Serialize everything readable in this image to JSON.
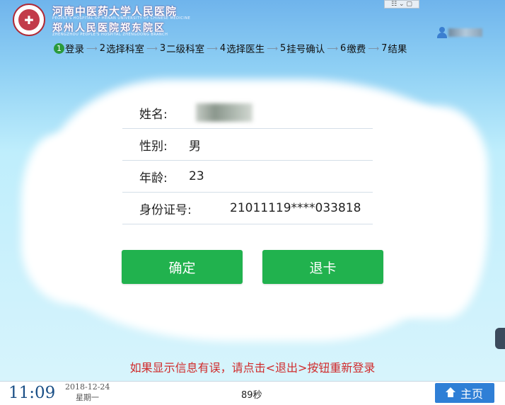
{
  "header": {
    "hospital_line1": "河南中医药大学人民医院",
    "hospital_line1_en": "PEOPLE'S HOSPITAL OF HENAN UNIVERSITY OF CHINESE MEDICINE",
    "hospital_line2": "郑州人民医院郑东院区",
    "hospital_line2_en": "ZHENGZHOU PEOPLE'S HOSPITAL ZHENGDONG BRANCH",
    "window_controls": "☷ ⌄ ▢"
  },
  "steps": [
    {
      "num": "1",
      "label": "登录",
      "active": true
    },
    {
      "num": "2",
      "label": "选择科室",
      "active": false
    },
    {
      "num": "3",
      "label": "二级科室",
      "active": false
    },
    {
      "num": "4",
      "label": "选择医生",
      "active": false
    },
    {
      "num": "5",
      "label": "挂号确认",
      "active": false
    },
    {
      "num": "6",
      "label": "缴费",
      "active": false
    },
    {
      "num": "7",
      "label": "结果",
      "active": false
    }
  ],
  "patient": {
    "name_label": "姓名:",
    "gender_label": "性别:",
    "gender_value": "男",
    "age_label": "年龄:",
    "age_value": "23",
    "id_label": "身份证号:",
    "id_value": "21011119****033818"
  },
  "buttons": {
    "confirm": "确定",
    "exit_card": "退卡"
  },
  "warning": "如果显示信息有误，请点击<退出>按钮重新登录",
  "footer": {
    "time": "11:09",
    "date": "2018-12-24",
    "weekday": "星期一",
    "countdown": "89秒",
    "home": "主页"
  }
}
